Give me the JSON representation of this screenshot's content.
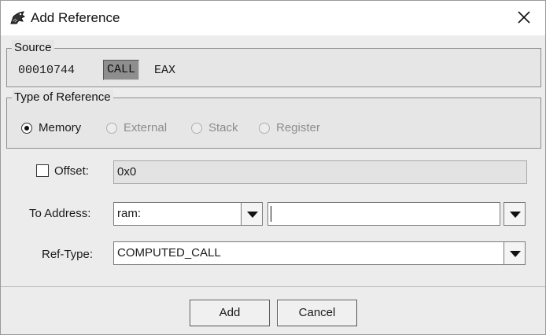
{
  "window": {
    "title": "Add Reference"
  },
  "source": {
    "label": "Source",
    "address": "00010744",
    "mnemonic": "CALL",
    "operand": "EAX"
  },
  "type_of_reference": {
    "label": "Type of Reference",
    "options": [
      {
        "label": "Memory",
        "selected": true,
        "enabled": true
      },
      {
        "label": "External",
        "selected": false,
        "enabled": false
      },
      {
        "label": "Stack",
        "selected": false,
        "enabled": false
      },
      {
        "label": "Register",
        "selected": false,
        "enabled": false
      }
    ]
  },
  "offset": {
    "label": "Offset:",
    "checked": false,
    "value": "0x0"
  },
  "to_address": {
    "label": "To Address:",
    "space": "ram:",
    "value": ""
  },
  "ref_type": {
    "label": "Ref-Type:",
    "value": "COMPUTED_CALL"
  },
  "buttons": {
    "add": "Add",
    "cancel": "Cancel"
  },
  "icons": {
    "window": "dragon-app-icon",
    "close": "close-icon",
    "dropdown": "chevron-down-icon"
  }
}
